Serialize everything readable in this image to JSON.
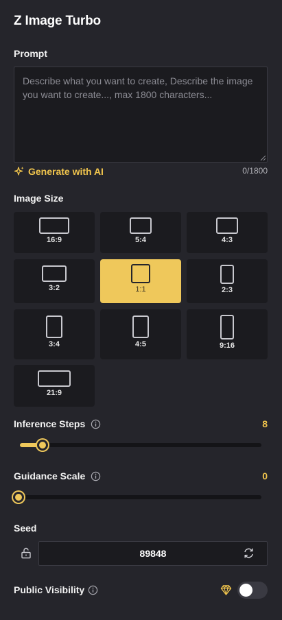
{
  "app": {
    "title": "Z Image Turbo"
  },
  "prompt": {
    "label": "Prompt",
    "value": "",
    "placeholder": "Describe what you want to create, Describe the image you want to create..., max 1800 characters...",
    "char_count": "0/1800",
    "generate_ai_label": "Generate with AI"
  },
  "image_size": {
    "label": "Image Size",
    "options": [
      "16:9",
      "5:4",
      "4:3",
      "3:2",
      "1:1",
      "2:3",
      "3:4",
      "4:5",
      "9:16",
      "21:9"
    ],
    "selected": "1:1"
  },
  "inference_steps": {
    "label": "Inference Steps",
    "value": "8",
    "fraction": 0.09
  },
  "guidance_scale": {
    "label": "Guidance Scale",
    "value": "0",
    "fraction": 0
  },
  "seed": {
    "label": "Seed",
    "value": "89848"
  },
  "visibility": {
    "label": "Public Visibility",
    "enabled": false
  },
  "colors": {
    "accent": "#efc85b",
    "background": "#25252b",
    "panel": "#1b1b1f"
  }
}
